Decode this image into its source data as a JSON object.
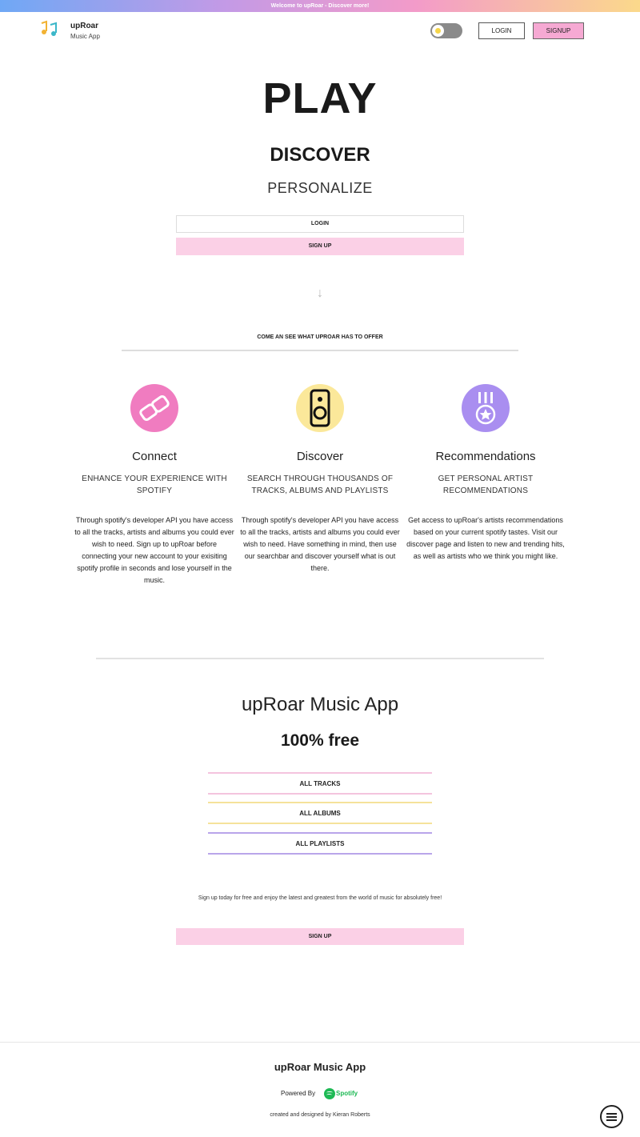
{
  "banner": {
    "text": "Welcome to upRoar - Discover more!"
  },
  "header": {
    "brand": "upRoar",
    "brand_sub": "Music App",
    "login_label": "LOGIN",
    "signup_label": "SIGNUP"
  },
  "hero": {
    "play": "PLAY",
    "discover": "DISCOVER",
    "personalize": "PERSONALIZE",
    "login_label": "LOGIN",
    "signup_label": "SIGN UP",
    "arrow": "↓"
  },
  "offer": {
    "text": "COME AN SEE WHAT UPROAR HAS TO OFFER"
  },
  "features": [
    {
      "title": "Connect",
      "subtitle": "ENHANCE YOUR EXPERIENCE WITH SPOTIFY",
      "body": "Through spotify's developer API you have access to all the tracks, artists and albums you could ever wish to need. Sign up to upRoar before connecting your new account to your exisiting spotify profile in seconds and lose yourself in the music.",
      "icon": "link-icon",
      "color": "#f07cc0"
    },
    {
      "title": "Discover",
      "subtitle": "SEARCH THROUGH THOUSANDS OF TRACKS, ALBUMS AND PLAYLISTS",
      "body": "Through spotify's developer API you have access to all the tracks, artists and albums you could ever wish to need. Have something in mind, then use our searchbar and discover yourself what is out there.",
      "icon": "speaker-icon",
      "color": "#fbe89a"
    },
    {
      "title": "Recommendations",
      "subtitle": "GET PERSONAL ARTIST RECOMMENDATIONS",
      "body": "Get access to upRoar's artists recommendations based on your current spotify tastes. Visit our discover page and listen to new and trending hits, as well as artists who we think you might like.",
      "icon": "medal-star-icon",
      "color": "#a98ef0"
    }
  ],
  "promo": {
    "title": "upRoar Music App",
    "free": "100% free",
    "categories": [
      "ALL TRACKS",
      "ALL ALBUMS",
      "ALL PLAYLISTS"
    ],
    "signup_text": "Sign up today for free and enjoy the latest and greatest from the world of music for absolutely free!",
    "signup_label": "SIGN UP"
  },
  "footer": {
    "title": "upRoar Music App",
    "powered_by": "Powered By",
    "spotify": "Spotify",
    "credits": "created and designed by Kieran Roberts"
  },
  "colors": {
    "accent_pink": "#f6a9d3",
    "spotify_green": "#1db954"
  }
}
